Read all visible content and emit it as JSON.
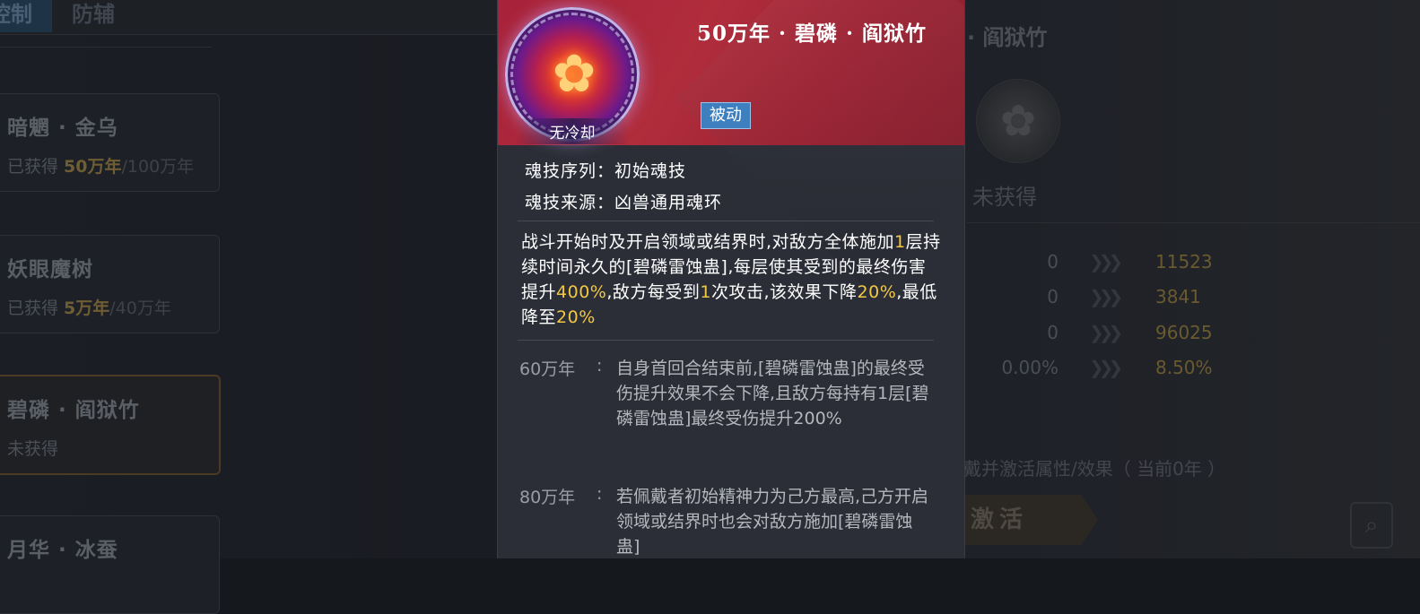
{
  "background": {
    "tabs": [
      "控制",
      "防辅"
    ],
    "cards": [
      {
        "name": "暗魍 · 金乌",
        "status_prefix": "已获得 ",
        "status_value": "50万年",
        "status_suffix": "/100万年"
      },
      {
        "name": "妖眼魔树",
        "status_prefix": "已获得 ",
        "status_value": "5万年",
        "status_suffix": "/40万年"
      },
      {
        "name": "碧磷 · 阎狱竹",
        "status_prefix": "未获得",
        "status_value": "",
        "status_suffix": ""
      },
      {
        "name": "月华 · 冰蚕",
        "status_prefix": "",
        "status_value": "",
        "status_suffix": ""
      }
    ],
    "right_panel": {
      "title": "· 阎狱竹",
      "status": "未获得",
      "stats": [
        {
          "current": "0",
          "next": "11523"
        },
        {
          "current": "0",
          "next": "3841"
        },
        {
          "current": "0",
          "next": "96025"
        },
        {
          "current": "0.00%",
          "next": "8.50%"
        }
      ],
      "note": "戴并激活属性/效果（ 当前0年 ）",
      "activate_label": "激活"
    }
  },
  "popup": {
    "title": "50万年 · 碧磷 · 阎狱竹",
    "cooldown": "无冷却",
    "type_badge": "被动",
    "sequence": "魂技序列：初始魂技",
    "source": "魂技来源：凶兽通用魂环",
    "description_segments": [
      {
        "text": "战斗开始时及开启领域或结界时,对敌方全体施加",
        "hl": false
      },
      {
        "text": "1",
        "hl": true
      },
      {
        "text": "层持续时间永久的[碧磷雷蚀蛊],每层使其受到的最终伤害提升",
        "hl": false
      },
      {
        "text": "400%",
        "hl": true
      },
      {
        "text": ",敌方每受到",
        "hl": false
      },
      {
        "text": "1",
        "hl": true
      },
      {
        "text": "次攻击,该效果下降",
        "hl": false
      },
      {
        "text": "20%",
        "hl": true
      },
      {
        "text": ",最低降至",
        "hl": false
      },
      {
        "text": "20%",
        "hl": true
      }
    ],
    "tiers": [
      {
        "level": "60万年",
        "text": "自身首回合结束前,[碧磷雷蚀蛊]的最终受伤提升效果不会下降,且敌方每持有1层[碧磷雷蚀蛊]最终受伤提升200%"
      },
      {
        "level": "80万年",
        "text": "若佩戴者初始精神力为己方最高,己方开启领域或结界时也会对敌方施加[碧磷雷蚀蛊]"
      }
    ]
  },
  "colors": {
    "highlight": "#f3c845",
    "header_red": "#a8223a",
    "badge_blue": "#3d7fbf",
    "panel_bg": "#2b2e37"
  },
  "icons": [
    "flower-emblem-icon",
    "search-icon",
    "double-arrow-icon"
  ]
}
